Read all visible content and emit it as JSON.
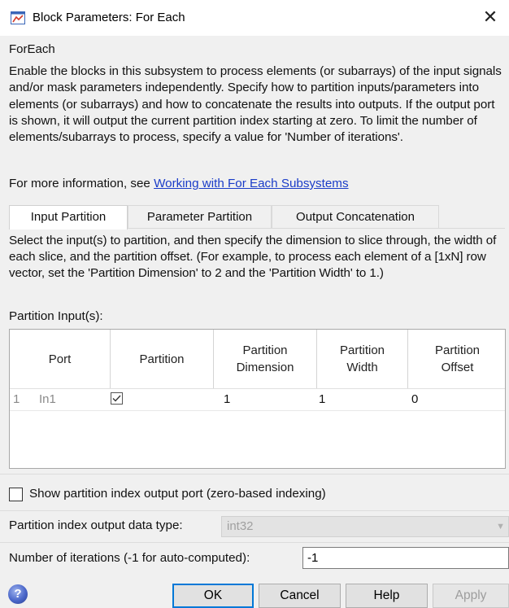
{
  "window": {
    "title": "Block Parameters: For Each",
    "close_glyph": "✕"
  },
  "block_name": "ForEach",
  "description": "Enable the blocks in this subsystem to process elements (or subarrays) of the input signals and/or mask parameters independently. Specify how to partition inputs/parameters into elements (or subarrays) and how to concatenate the results into outputs. If the output port is shown, it will output the current partition index starting at zero.  To limit the number of elements/subarrays to process, specify a value for 'Number of iterations'.",
  "more_info": {
    "prefix": "For more information, see ",
    "link_text": "Working with For Each Subsystems"
  },
  "tabs": [
    {
      "label": "Input Partition",
      "active": true
    },
    {
      "label": "Parameter Partition",
      "active": false
    },
    {
      "label": "Output Concatenation",
      "active": false
    }
  ],
  "instructions": "Select the input(s) to partition, and then specify the dimension to slice through, the width of each slice, and the partition offset. (For example, to process each element of a [1xN] row vector, set the 'Partition Dimension' to 2 and the 'Partition Width' to 1.)",
  "partition_inputs_label": "Partition Input(s):",
  "table": {
    "columns": [
      "Port",
      "Partition",
      "Partition Dimension",
      "Partition Width",
      "Partition Offset"
    ],
    "rows": [
      {
        "index": "1",
        "port": "In1",
        "partition_checked": true,
        "dimension": "1",
        "width": "1",
        "offset": "0"
      }
    ]
  },
  "show_index_port": {
    "label": "Show partition index output port (zero-based indexing)",
    "checked": false
  },
  "index_data_type": {
    "label": "Partition index output data type:",
    "value": "int32",
    "enabled": false
  },
  "iterations": {
    "label": "Number of iterations (-1 for auto-computed):",
    "value": "-1"
  },
  "buttons": {
    "ok": "OK",
    "cancel": "Cancel",
    "help": "Help",
    "apply": "Apply"
  },
  "colors": {
    "link": "#1a3cc8",
    "dialog_bg": "#f0f0f0",
    "default_button_border": "#0078d7"
  },
  "icons": {
    "title": "simulink-block-icon",
    "help": "help-question-icon",
    "check": "checkmark-icon"
  }
}
